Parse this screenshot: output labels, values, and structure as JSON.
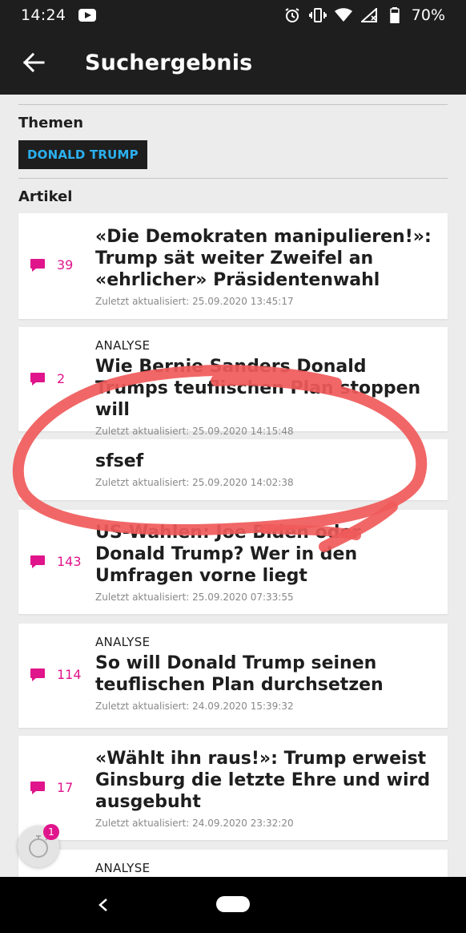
{
  "status_bar": {
    "time": "14:24",
    "battery": "70%",
    "icons": [
      "youtube-icon",
      "alarm-icon",
      "vibrate-icon",
      "wifi-icon",
      "signal-icon",
      "battery-icon"
    ]
  },
  "app_bar": {
    "title": "Suchergebnis",
    "back_icon": "arrow-left-icon"
  },
  "topics": {
    "label": "Themen",
    "tags": [
      "DONALD TRUMP"
    ]
  },
  "articles": {
    "label": "Artikel",
    "items": [
      {
        "kicker": "",
        "title": "«Die Demokraten manipulieren!»: Trump sät weiter Zweifel an «ehrlicher» Präsidentenwahl",
        "date": "Zuletzt aktualisiert: 25.09.2020 13:45:17",
        "comments": "39"
      },
      {
        "kicker": "ANALYSE",
        "title": "Wie Bernie Sanders Donald Trumps teuflischen Plan stoppen will",
        "date": "Zuletzt aktualisiert: 25.09.2020 14:15:48",
        "comments": "2"
      },
      {
        "kicker": "",
        "title": "sfsef",
        "date": "Zuletzt aktualisiert: 25.09.2020 14:02:38",
        "comments": ""
      },
      {
        "kicker": "",
        "title": "US-Wahlen: Joe Biden oder Donald Trump? Wer in den Umfragen vorne liegt",
        "date": "Zuletzt aktualisiert: 25.09.2020 07:33:55",
        "comments": "143"
      },
      {
        "kicker": "ANALYSE",
        "title": "So will Donald Trump seinen teuflischen Plan durchsetzen",
        "date": "Zuletzt aktualisiert: 24.09.2020 15:39:32",
        "comments": "114"
      },
      {
        "kicker": "",
        "title": "«Wählt ihn raus!»: Trump erweist Ginsburg die letzte Ehre und wird ausgebuht",
        "date": "Zuletzt aktualisiert: 24.09.2020 23:32:20",
        "comments": "17"
      },
      {
        "kicker": "ANALYSE",
        "title": "",
        "date": "",
        "comments": ""
      }
    ]
  },
  "fab": {
    "badge": "1",
    "icon": "timer-icon"
  },
  "colors": {
    "accent": "#e0148b",
    "tag_text": "#2bb0ef",
    "bar": "#1e1e1e",
    "annotation": "#f05a5a"
  }
}
